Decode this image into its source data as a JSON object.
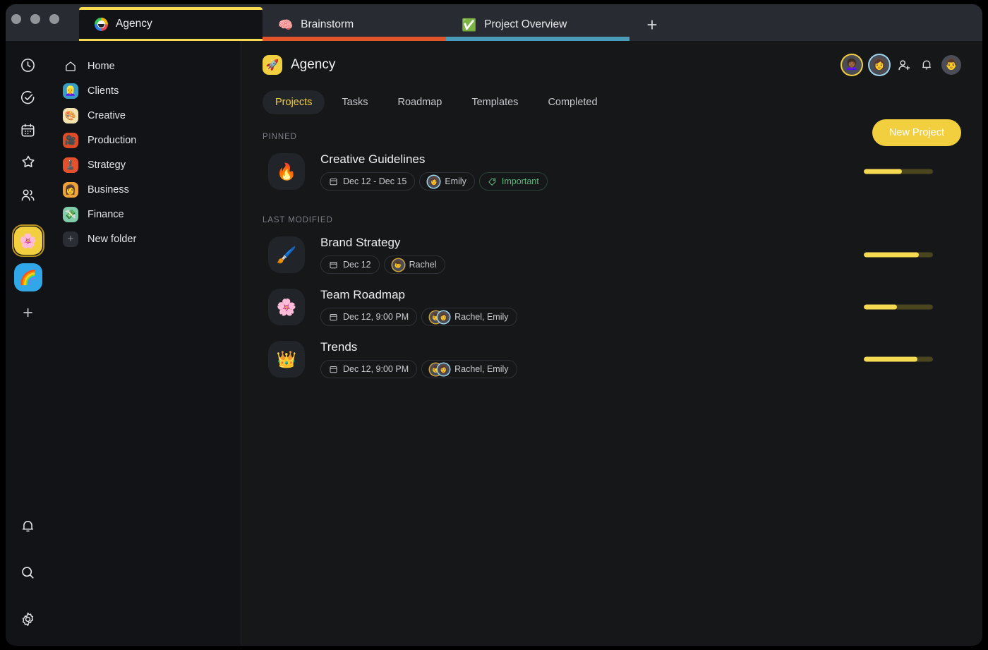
{
  "window": {
    "traffic_lights": [
      "close",
      "minimize",
      "maximize"
    ]
  },
  "tabs": [
    {
      "label": "Agency",
      "icon": "agency-ring-icon",
      "active": true,
      "accent": "#f5da52"
    },
    {
      "label": "Brainstorm",
      "icon": "brain-emoji",
      "emoji": "🧠",
      "active": false,
      "accent": "#e0552a"
    },
    {
      "label": "Project Overview",
      "icon": "check-mark-button-emoji",
      "emoji": "✅",
      "active": false,
      "accent": "#4a9cba"
    }
  ],
  "new_tab_label": "+",
  "rail": {
    "icons": [
      {
        "name": "clock-icon"
      },
      {
        "name": "check-circle-icon"
      },
      {
        "name": "calendar-icon"
      },
      {
        "name": "star-icon"
      },
      {
        "name": "people-icon"
      }
    ],
    "workspaces": [
      {
        "name": "workspace-agency",
        "emoji": "🌸",
        "color": "#f2cf3f",
        "active": true
      },
      {
        "name": "workspace-rainbow",
        "emoji": "🌈",
        "color": "#2fa7e8",
        "active": false
      }
    ],
    "add_label": "+",
    "bottom_icons": [
      {
        "name": "bell-icon"
      },
      {
        "name": "search-icon"
      },
      {
        "name": "gear-icon"
      }
    ]
  },
  "sidebar": {
    "items": [
      {
        "label": "Home",
        "icon": "home-icon",
        "emoji": "",
        "bg": ""
      },
      {
        "label": "Clients",
        "icon": "clients-folder-icon",
        "emoji": "👱‍♀️",
        "bg": "#3a9cc4"
      },
      {
        "label": "Creative",
        "icon": "creative-folder-icon",
        "emoji": "🎨",
        "bg": "#f2e3b0"
      },
      {
        "label": "Production",
        "icon": "production-folder-icon",
        "emoji": "🎥",
        "bg": "#e04a25"
      },
      {
        "label": "Strategy",
        "icon": "strategy-folder-icon",
        "emoji": "♟️",
        "bg": "#e2502c"
      },
      {
        "label": "Business",
        "icon": "business-folder-icon",
        "emoji": "👩",
        "bg": "#eda338"
      },
      {
        "label": "Finance",
        "icon": "finance-folder-icon",
        "emoji": "💸",
        "bg": "#7fcbaa"
      },
      {
        "label": "New folder",
        "icon": "plus-icon",
        "emoji": "+",
        "bg": "#2a2d33"
      }
    ]
  },
  "header": {
    "project_emoji": "🚀",
    "project_title": "Agency",
    "avatars": [
      {
        "name": "member-avatar-1",
        "ring": "#f2cf3f",
        "emoji": "👩🏾‍🦱"
      },
      {
        "name": "member-avatar-2",
        "ring": "#9fd3ea",
        "emoji": "👩"
      }
    ],
    "add_person_label": "add-person",
    "bell_label": "notifications",
    "user_avatar_emoji": "👨"
  },
  "nav": {
    "tabs": [
      {
        "label": "Projects",
        "selected": true
      },
      {
        "label": "Tasks",
        "selected": false
      },
      {
        "label": "Roadmap",
        "selected": false
      },
      {
        "label": "Templates",
        "selected": false
      },
      {
        "label": "Completed",
        "selected": false
      }
    ],
    "new_project_button": "New Project"
  },
  "sections": [
    {
      "label": "PINNED",
      "rows": [
        {
          "emoji": "🔥",
          "title": "Creative Guidelines",
          "date": "Dec 12 - Dec 15",
          "people": "Emily",
          "people_avatars": [
            "👩"
          ],
          "tag": "Important",
          "progress": 55
        }
      ]
    },
    {
      "label": "LAST MODIFIED",
      "rows": [
        {
          "emoji": "🖌️",
          "title": "Brand Strategy",
          "date": "Dec 12",
          "people": "Rachel",
          "people_avatars": [
            "👦"
          ],
          "tag": "",
          "progress": 80
        },
        {
          "emoji": "🌸",
          "title": "Team Roadmap",
          "date": "Dec 12, 9:00 PM",
          "people": "Rachel, Emily",
          "people_avatars": [
            "👦",
            "👩"
          ],
          "tag": "",
          "progress": 48
        },
        {
          "emoji": "👑",
          "title": "Trends",
          "date": "Dec 12, 9:00 PM",
          "people": "Rachel, Emily",
          "people_avatars": [
            "👦",
            "👩"
          ],
          "tag": "",
          "progress": 78
        }
      ]
    }
  ],
  "colors": {
    "accent_yellow": "#f5da52",
    "tag_green": "#5fb97f",
    "tab_orange": "#e0552a",
    "tab_teal": "#4a9cba",
    "bg_app": "#111317",
    "bg_main": "#151719"
  }
}
